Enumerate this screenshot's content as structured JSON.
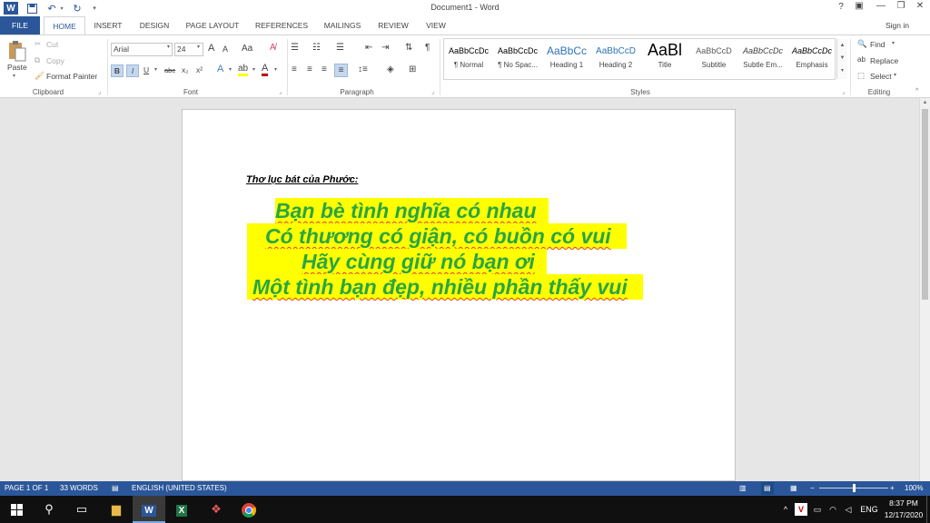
{
  "window": {
    "title": "Document1 - Word",
    "help": "?",
    "sign_in": "Sign in"
  },
  "qat": {
    "save_icon": "save-icon",
    "undo_icon": "undo-icon",
    "redo_icon": "redo-icon"
  },
  "tabs": [
    "FILE",
    "HOME",
    "INSERT",
    "DESIGN",
    "PAGE LAYOUT",
    "REFERENCES",
    "MAILINGS",
    "REVIEW",
    "VIEW"
  ],
  "clipboard": {
    "paste": "Paste",
    "cut": "Cut",
    "copy": "Copy",
    "format_painter": "Format Painter",
    "label": "Clipboard"
  },
  "font": {
    "name": "Arial",
    "size": "24",
    "label": "Font",
    "bold": "B",
    "italic": "I",
    "underline": "U",
    "strike": "abc",
    "sub": "x₂",
    "sup": "x²",
    "grow": "A",
    "shrink": "A",
    "case": "Aa"
  },
  "paragraph": {
    "label": "Paragraph",
    "pilcrow": "¶"
  },
  "styles": {
    "label": "Styles",
    "items": [
      {
        "preview": "AaBbCcDc",
        "name": "¶ Normal"
      },
      {
        "preview": "AaBbCcDc",
        "name": "¶ No Spac..."
      },
      {
        "preview": "AaBbCc",
        "name": "Heading 1"
      },
      {
        "preview": "AaBbCcD",
        "name": "Heading 2"
      },
      {
        "preview": "AaBl",
        "name": "Title"
      },
      {
        "preview": "AaBbCcD",
        "name": "Subtitle"
      },
      {
        "preview": "AaBbCcDc",
        "name": "Subtle Em..."
      },
      {
        "preview": "AaBbCcDc",
        "name": "Emphasis"
      }
    ]
  },
  "editing": {
    "find": "Find",
    "replace": "Replace",
    "select": "Select",
    "label": "Editing"
  },
  "document": {
    "heading": "Thơ lục bát của Phước:",
    "lines": [
      "Bạn bè tình nghĩa có nhau",
      "Có thương có giận, có buồn có vui",
      "Hãy cùng giữ nó bạn ơi",
      "Một tình bạn đẹp, nhiều phần thấy vui"
    ]
  },
  "status": {
    "page": "PAGE 1 OF 1",
    "words": "33 WORDS",
    "language": "ENGLISH (UNITED STATES)",
    "zoom": "100%",
    "zoom_level": 1.0
  },
  "taskbar": {
    "lang": "ENG",
    "time": "8:37 PM",
    "date": "12/17/2020"
  },
  "colors": {
    "accent": "#2b579a",
    "highlight": "#ffff00",
    "text_green": "#2aa543"
  }
}
